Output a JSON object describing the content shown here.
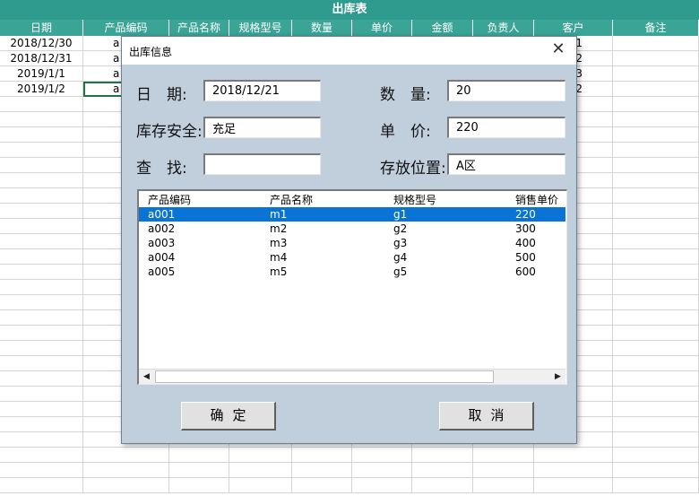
{
  "sheet": {
    "title": "出库表",
    "headers": [
      "日期",
      "产品编码",
      "产品名称",
      "规格型号",
      "数量",
      "单价",
      "金额",
      "负责人",
      "客户",
      "备注"
    ],
    "rows": [
      {
        "date": "2018/12/30",
        "code": "a",
        "client_tail": "1"
      },
      {
        "date": "2018/12/31",
        "code": "a",
        "client_tail": "2"
      },
      {
        "date": "2019/1/1",
        "code": "a",
        "client_tail": "3"
      },
      {
        "date": "2019/1/2",
        "code": "a",
        "client_tail": "2"
      }
    ]
  },
  "dialog": {
    "title": "出库信息",
    "close_glyph": "✕",
    "labels": {
      "date": "日　期:",
      "stock_safety": "库存安全:",
      "search": "查　找:",
      "quantity": "数　量:",
      "unit_price": "单　价:",
      "location": "存放位置:"
    },
    "fields": {
      "date": "2018/12/21",
      "stock_safety": "充足",
      "search": "",
      "quantity": "20",
      "unit_price": "220",
      "location": "A区"
    },
    "list": {
      "headers": [
        "产品编码",
        "产品名称",
        "规格型号",
        "销售单价"
      ],
      "rows": [
        [
          "a001",
          "m1",
          "g1",
          "220"
        ],
        [
          "a002",
          "m2",
          "g2",
          "300"
        ],
        [
          "a003",
          "m3",
          "g3",
          "400"
        ],
        [
          "a004",
          "m4",
          "g4",
          "500"
        ],
        [
          "a005",
          "m5",
          "g5",
          "600"
        ]
      ],
      "selected_index": 0
    },
    "scroll_left_glyph": "◀",
    "scroll_right_glyph": "▶",
    "buttons": {
      "ok": "确定",
      "cancel": "取消"
    }
  },
  "colors": {
    "header_teal": "#2e9b8e",
    "dialog_bg": "#c1cfdd",
    "selection_blue": "#0a73d6"
  }
}
